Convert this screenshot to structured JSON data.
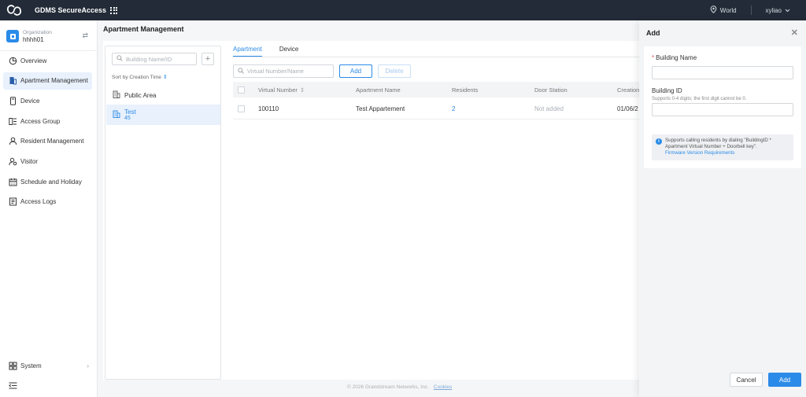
{
  "header": {
    "app_title": "GDMS SecureAccess",
    "region": "World",
    "user": "xyliao"
  },
  "sidebar": {
    "org_label": "Organization",
    "org_name": "hhhh01",
    "items": [
      {
        "label": "Overview",
        "icon": "overview-icon"
      },
      {
        "label": "Apartment Management",
        "icon": "apartment-icon"
      },
      {
        "label": "Device",
        "icon": "device-icon"
      },
      {
        "label": "Access Group",
        "icon": "access-group-icon"
      },
      {
        "label": "Resident Management",
        "icon": "resident-icon"
      },
      {
        "label": "Visitor",
        "icon": "visitor-icon"
      },
      {
        "label": "Schedule and Holiday",
        "icon": "calendar-icon"
      },
      {
        "label": "Access Logs",
        "icon": "logs-icon"
      }
    ],
    "system_label": "System"
  },
  "main": {
    "page_title": "Apartment Management",
    "building_search_placeholder": "Building Name/ID",
    "sort_label": "Sort by Creation Time",
    "buildings": [
      {
        "name": "Public Area",
        "sub": ""
      },
      {
        "name": "Test",
        "sub": "45"
      }
    ],
    "tabs": [
      "Apartment",
      "Device"
    ],
    "vn_search_placeholder": "Virtual Number/Name",
    "add_label": "Add",
    "delete_label": "Delete",
    "table": {
      "columns": [
        "Virtual Number",
        "Apartment Name",
        "Residents",
        "Door Station",
        "Creation"
      ],
      "rows": [
        {
          "virtual_number": "100110",
          "apartment_name": "Test Appartement",
          "residents": "2",
          "door_station": "Not added",
          "creation": "01/06/2"
        }
      ]
    },
    "footer_copyright": "© 2026 Grandstream Networks, Inc.",
    "footer_cookies": "Cookies"
  },
  "drawer": {
    "title": "Add",
    "building_name_label": "Building Name",
    "building_id_label": "Building ID",
    "building_id_hint": "Supports 0-4 digits; the first digit cannot be 0.",
    "info_text": "Supports calling residents by dialing \"BuildingID * Apartment Virtual Number + Doorbell key\".",
    "info_link": "Firmware Version Requirements",
    "cancel_label": "Cancel",
    "confirm_label": "Add"
  },
  "colors": {
    "topbar": "#222b37",
    "accent": "#2b8be8",
    "required": "#e34d4d"
  }
}
